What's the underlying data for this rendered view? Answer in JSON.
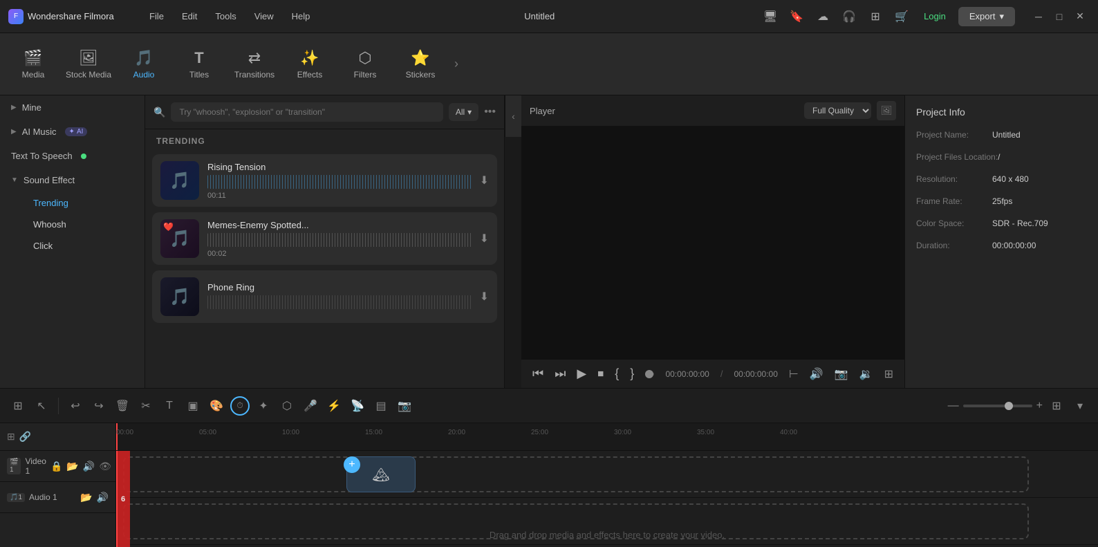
{
  "app": {
    "name": "Wondershare Filmora",
    "title": "Untitled"
  },
  "menu": {
    "items": [
      "File",
      "Edit",
      "Tools",
      "View",
      "Help"
    ]
  },
  "title_icons": [
    "monitor",
    "bookmark",
    "upload",
    "headphone",
    "grid",
    "cart"
  ],
  "login": "Login",
  "export": "Export",
  "toolbar": {
    "items": [
      {
        "label": "Media",
        "icon": "🎬"
      },
      {
        "label": "Stock Media",
        "icon": "🖼"
      },
      {
        "label": "Audio",
        "icon": "🎵",
        "active": true
      },
      {
        "label": "Titles",
        "icon": "T"
      },
      {
        "label": "Transitions",
        "icon": "↔"
      },
      {
        "label": "Effects",
        "icon": "✨"
      },
      {
        "label": "Filters",
        "icon": "⬡"
      },
      {
        "label": "Stickers",
        "icon": "⭐"
      }
    ]
  },
  "left_panel": {
    "sections": [
      {
        "type": "item",
        "label": "Mine",
        "expandable": true
      },
      {
        "type": "item",
        "label": "AI Music",
        "expandable": true,
        "badge": "AI"
      },
      {
        "type": "item",
        "label": "Text To Speech",
        "dot": true
      },
      {
        "type": "group",
        "label": "Sound Effect",
        "expandable": true,
        "children": [
          {
            "label": "Trending",
            "active": true
          },
          {
            "label": "Whoosh"
          },
          {
            "label": "Click"
          }
        ]
      }
    ]
  },
  "search": {
    "placeholder": "Try \"whoosh\", \"explosion\" or \"transition\"",
    "filter": "All"
  },
  "trending_label": "TRENDING",
  "sounds": [
    {
      "name": "Rising Tension",
      "duration": "00:11",
      "heart": true
    },
    {
      "name": "Memes-Enemy Spotted...",
      "duration": "00:02",
      "heart": true
    },
    {
      "name": "Phone Ring",
      "duration": "",
      "heart": false
    }
  ],
  "player": {
    "tab": "Player",
    "quality": "Full Quality",
    "time_current": "00:00:00:00",
    "time_total": "00:00:00:00"
  },
  "project_info": {
    "title": "Project Info",
    "name_label": "Project Name:",
    "name_value": "Untitled",
    "files_label": "Project Files Location:",
    "files_value": "/",
    "resolution_label": "Resolution:",
    "resolution_value": "640 x 480",
    "frame_rate_label": "Frame Rate:",
    "frame_rate_value": "25fps",
    "color_space_label": "Color Space:",
    "color_space_value": "SDR - Rec.709",
    "duration_label": "Duration:",
    "duration_value": "00:00:00:00"
  },
  "timeline": {
    "ruler_marks": [
      "00:00:00:00",
      "00:00:05:00",
      "00:00:10:00",
      "00:00:15:00",
      "00:00:20:00",
      "00:00:25:00",
      "00:00:30:00",
      "00:00:35:00",
      "00:00:40:00"
    ],
    "ruler_short": [
      "00:00",
      "05:00",
      "10:00",
      "15:00",
      "20:00",
      "25:00",
      "30:00",
      "35:00",
      "40:00"
    ],
    "tracks": [
      {
        "label": "Video 1",
        "type": "video",
        "num": "1"
      },
      {
        "label": "Audio 1",
        "type": "audio",
        "num": "1"
      }
    ],
    "drag_hint": "Drag and drop media and effects here to create your video."
  }
}
